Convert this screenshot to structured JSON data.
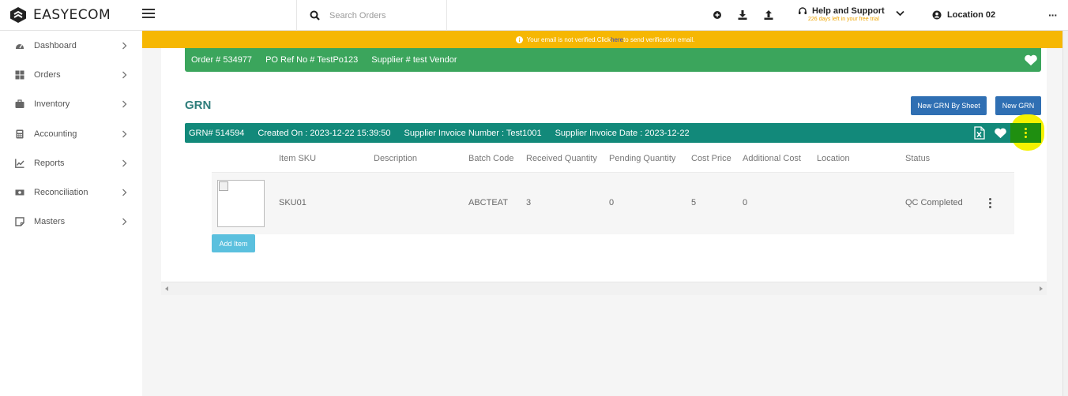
{
  "app": {
    "logo_text": "EASYECOM"
  },
  "header": {
    "search_placeholder": "Search Orders",
    "help_title": "Help and Support",
    "trial_text": "226 days left in your free trial",
    "location": "Location 02",
    "more": "···"
  },
  "banner": {
    "text_before": "Your email is not verified.Click ",
    "link": "here",
    "text_after": " to send verification email."
  },
  "sidebar": {
    "items": [
      {
        "label": "Dashboard",
        "icon": "dashboard-icon"
      },
      {
        "label": "Orders",
        "icon": "grid-icon"
      },
      {
        "label": "Inventory",
        "icon": "briefcase-icon"
      },
      {
        "label": "Accounting",
        "icon": "calculator-icon"
      },
      {
        "label": "Reports",
        "icon": "chart-icon"
      },
      {
        "label": "Reconciliation",
        "icon": "money-icon"
      },
      {
        "label": "Masters",
        "icon": "note-icon"
      }
    ]
  },
  "order": {
    "order_no": "Order # 534977",
    "po_ref": "PO Ref No # TestPo123",
    "supplier": "Supplier # test Vendor"
  },
  "grn": {
    "title": "GRN",
    "btn_sheet": "New GRN By Sheet",
    "btn_new": "New GRN",
    "grn_no": "GRN# 514594",
    "created_on": "Created On : 2023-12-22 15:39:50",
    "invoice_number": "Supplier Invoice Number : Test1001",
    "invoice_date": "Supplier Invoice Date : 2023-12-22"
  },
  "table": {
    "headers": [
      "Item SKU",
      "Description",
      "Batch Code",
      "Received Quantity",
      "Pending Quantity",
      "Cost Price",
      "Additional Cost",
      "Location",
      "Status"
    ],
    "row": {
      "sku": "SKU01",
      "description": "",
      "batch_code": "ABCTEAT",
      "received": "3",
      "pending": "0",
      "cost_price": "5",
      "additional_cost": "0",
      "location": "",
      "status": "QC Completed"
    },
    "add_item": "Add Item"
  },
  "colors": {
    "order_bar": "#3ba55c",
    "grn_bar": "#12897a",
    "banner": "#f6b703",
    "button": "#2f6fb3",
    "highlight": "#f5f200"
  }
}
